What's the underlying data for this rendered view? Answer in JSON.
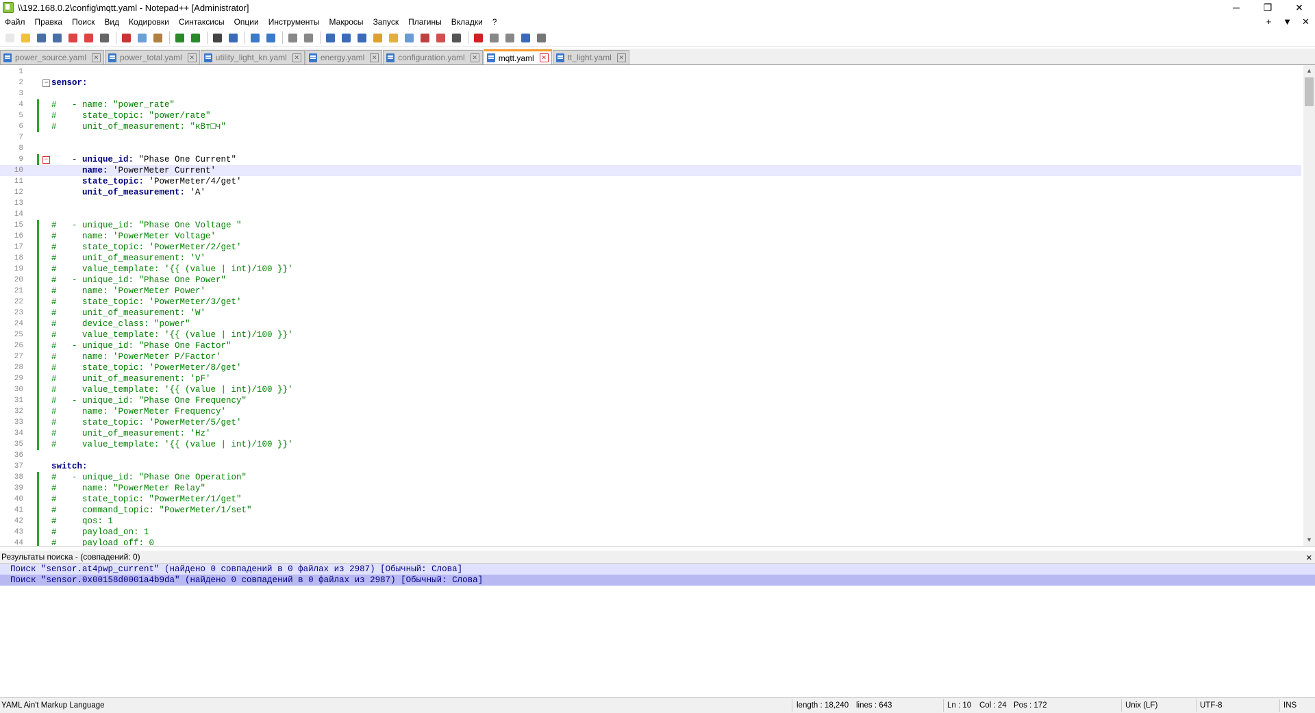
{
  "window": {
    "title": "\\\\192.168.0.2\\config\\mqtt.yaml - Notepad++ [Administrator]",
    "minimize": "─",
    "restore": "❐",
    "close": "✕"
  },
  "menu": {
    "items": [
      "Файл",
      "Правка",
      "Поиск",
      "Вид",
      "Кодировки",
      "Синтаксисы",
      "Опции",
      "Инструменты",
      "Макросы",
      "Запуск",
      "Плагины",
      "Вкладки",
      "?"
    ],
    "right": [
      "+",
      "▼",
      "✕"
    ]
  },
  "toolbar": {
    "buttons": [
      {
        "name": "new-file-icon",
        "color": "#e8e8e8"
      },
      {
        "name": "open-file-icon",
        "color": "#f0c040"
      },
      {
        "name": "save-icon",
        "color": "#4a6fa5"
      },
      {
        "name": "save-all-icon",
        "color": "#4a6fa5"
      },
      {
        "name": "close-icon",
        "color": "#d44"
      },
      {
        "name": "close-all-icon",
        "color": "#d44"
      },
      {
        "name": "print-icon",
        "color": "#666"
      },
      {
        "sep": true
      },
      {
        "name": "cut-icon",
        "color": "#c33"
      },
      {
        "name": "copy-icon",
        "color": "#6aa0d8"
      },
      {
        "name": "paste-icon",
        "color": "#b08040"
      },
      {
        "sep": true
      },
      {
        "name": "undo-icon",
        "color": "#2a8a2a"
      },
      {
        "name": "redo-icon",
        "color": "#2a8a2a"
      },
      {
        "sep": true
      },
      {
        "name": "find-icon",
        "color": "#444"
      },
      {
        "name": "replace-icon",
        "color": "#3a6ab8"
      },
      {
        "sep": true
      },
      {
        "name": "zoom-in-icon",
        "color": "#3a7ac8"
      },
      {
        "name": "zoom-out-icon",
        "color": "#3a7ac8"
      },
      {
        "sep": true
      },
      {
        "name": "sync-vertical-icon",
        "color": "#888"
      },
      {
        "name": "sync-horizontal-icon",
        "color": "#888"
      },
      {
        "sep": true
      },
      {
        "name": "word-wrap-icon",
        "color": "#3a6ab8"
      },
      {
        "name": "show-all-chars-icon",
        "color": "#3a6ab8"
      },
      {
        "name": "indent-guide-icon",
        "color": "#3a6ab8"
      },
      {
        "name": "user-language-icon",
        "color": "#e0a030"
      },
      {
        "name": "document-map-icon",
        "color": "#e0b040"
      },
      {
        "name": "function-list-icon",
        "color": "#6a9ad8"
      },
      {
        "name": "folder-workspace-icon",
        "color": "#c04040"
      },
      {
        "name": "monitoring-icon",
        "color": "#d05050"
      },
      {
        "name": "eye-icon",
        "color": "#555"
      },
      {
        "sep": true
      },
      {
        "name": "record-macro-icon",
        "color": "#d02020"
      },
      {
        "name": "stop-macro-icon",
        "color": "#888"
      },
      {
        "name": "play-macro-icon",
        "color": "#888"
      },
      {
        "name": "run-macro-multiple-icon",
        "color": "#3a6ab8"
      },
      {
        "name": "save-macro-icon",
        "color": "#777"
      }
    ]
  },
  "tabs": [
    {
      "label": "power_source.yaml",
      "active": false
    },
    {
      "label": "power_total.yaml",
      "active": false
    },
    {
      "label": "utility_light_kn.yaml",
      "active": false
    },
    {
      "label": "energy.yaml",
      "active": false
    },
    {
      "label": "configuration.yaml",
      "active": false
    },
    {
      "label": "mqtt.yaml",
      "active": true
    },
    {
      "label": "tt_light.yaml",
      "active": false
    }
  ],
  "editor": {
    "current_line": 10,
    "lines": [
      {
        "n": "1",
        "t": ""
      },
      {
        "n": "2",
        "t": "sensor:",
        "k": "key",
        "fold": "open"
      },
      {
        "n": "3",
        "t": ""
      },
      {
        "n": "4",
        "t": "#   - name: \"power_rate\"",
        "k": "comment",
        "mark": "green"
      },
      {
        "n": "5",
        "t": "#     state_topic: \"power/rate\"",
        "k": "comment",
        "mark": "green"
      },
      {
        "n": "6",
        "t": "#     unit_of_measurement: \"кВт□ч\"",
        "k": "comment",
        "mark": "green"
      },
      {
        "n": "7",
        "t": ""
      },
      {
        "n": "8",
        "t": ""
      },
      {
        "n": "9",
        "t": "    - unique_id: \"Phase One Current\"",
        "k": "item",
        "fold": "open2",
        "mark": "green"
      },
      {
        "n": "10",
        "t": "      name: 'PowerMeter Current'",
        "k": "item"
      },
      {
        "n": "11",
        "t": "      state_topic: 'PowerMeter/4/get'",
        "k": "item"
      },
      {
        "n": "12",
        "t": "      unit_of_measurement: 'A'",
        "k": "item"
      },
      {
        "n": "13",
        "t": ""
      },
      {
        "n": "14",
        "t": ""
      },
      {
        "n": "15",
        "t": "#   - unique_id: \"Phase One Voltage \"",
        "k": "comment",
        "mark": "green"
      },
      {
        "n": "16",
        "t": "#     name: 'PowerMeter Voltage'",
        "k": "comment",
        "mark": "green"
      },
      {
        "n": "17",
        "t": "#     state_topic: 'PowerMeter/2/get'",
        "k": "comment",
        "mark": "green"
      },
      {
        "n": "18",
        "t": "#     unit_of_measurement: 'V'",
        "k": "comment",
        "mark": "green"
      },
      {
        "n": "19",
        "t": "#     value_template: '{{ (value | int)/100 }}'",
        "k": "comment",
        "mark": "green"
      },
      {
        "n": "20",
        "t": "#   - unique_id: \"Phase One Power\"",
        "k": "comment",
        "mark": "green"
      },
      {
        "n": "21",
        "t": "#     name: 'PowerMeter Power'",
        "k": "comment",
        "mark": "green"
      },
      {
        "n": "22",
        "t": "#     state_topic: 'PowerMeter/3/get'",
        "k": "comment",
        "mark": "green"
      },
      {
        "n": "23",
        "t": "#     unit_of_measurement: 'W'",
        "k": "comment",
        "mark": "green"
      },
      {
        "n": "24",
        "t": "#     device_class: \"power\"",
        "k": "comment",
        "mark": "green"
      },
      {
        "n": "25",
        "t": "#     value_template: '{{ (value | int)/100 }}'",
        "k": "comment",
        "mark": "green"
      },
      {
        "n": "26",
        "t": "#   - unique_id: \"Phase One Factor\"",
        "k": "comment",
        "mark": "green"
      },
      {
        "n": "27",
        "t": "#     name: 'PowerMeter P/Factor'",
        "k": "comment",
        "mark": "green"
      },
      {
        "n": "28",
        "t": "#     state_topic: 'PowerMeter/8/get'",
        "k": "comment",
        "mark": "green"
      },
      {
        "n": "29",
        "t": "#     unit_of_measurement: 'pF'",
        "k": "comment",
        "mark": "green"
      },
      {
        "n": "30",
        "t": "#     value_template: '{{ (value | int)/100 }}'",
        "k": "comment",
        "mark": "green"
      },
      {
        "n": "31",
        "t": "#   - unique_id: \"Phase One Frequency\"",
        "k": "comment",
        "mark": "green"
      },
      {
        "n": "32",
        "t": "#     name: 'PowerMeter Frequency'",
        "k": "comment",
        "mark": "green"
      },
      {
        "n": "33",
        "t": "#     state_topic: 'PowerMeter/5/get'",
        "k": "comment",
        "mark": "green"
      },
      {
        "n": "34",
        "t": "#     unit_of_measurement: 'Hz'",
        "k": "comment",
        "mark": "green"
      },
      {
        "n": "35",
        "t": "#     value_template: '{{ (value | int)/100 }}'",
        "k": "comment",
        "mark": "green"
      },
      {
        "n": "36",
        "t": ""
      },
      {
        "n": "37",
        "t": "switch:",
        "k": "key"
      },
      {
        "n": "38",
        "t": "#   - unique_id: \"Phase One Operation\"",
        "k": "comment",
        "mark": "green"
      },
      {
        "n": "39",
        "t": "#     name: \"PowerMeter Relay\"",
        "k": "comment",
        "mark": "green"
      },
      {
        "n": "40",
        "t": "#     state_topic: \"PowerMeter/1/get\"",
        "k": "comment",
        "mark": "green"
      },
      {
        "n": "41",
        "t": "#     command_topic: \"PowerMeter/1/set\"",
        "k": "comment",
        "mark": "green"
      },
      {
        "n": "42",
        "t": "#     qos: 1",
        "k": "comment",
        "mark": "green"
      },
      {
        "n": "43",
        "t": "#     payload_on: 1",
        "k": "comment",
        "mark": "green"
      },
      {
        "n": "44",
        "t": "#     payload_off: 0",
        "k": "comment",
        "mark": "green"
      }
    ]
  },
  "results": {
    "header": "Результаты поиска - (совпадений: 0)",
    "close": "✕",
    "lines": [
      "Поиск \"sensor.at4pwp_current\" (найдено 0 совпадений в 0 файлах из 2987) [Обычный: Слова]",
      "Поиск \"sensor.0x00158d0001a4b9da\" (найдено 0 совпадений в 0 файлах из 2987) [Обычный: Слова]"
    ]
  },
  "status": {
    "language": "YAML Ain't Markup Language",
    "length": "length : 18,240",
    "lines": "lines : 643",
    "ln": "Ln : 10",
    "col": "Col : 24",
    "pos": "Pos : 172",
    "eol": "Unix (LF)",
    "encoding": "UTF-8",
    "mode": "INS"
  }
}
